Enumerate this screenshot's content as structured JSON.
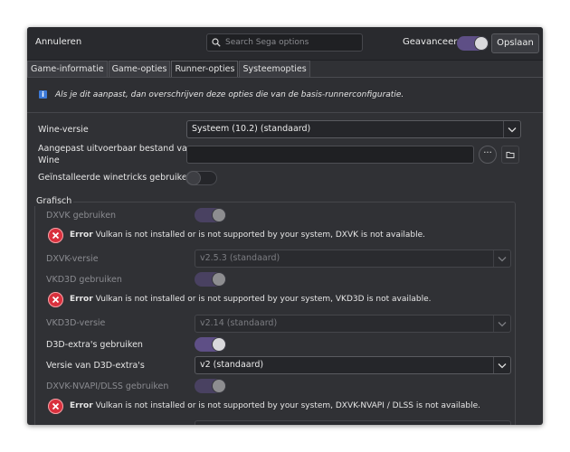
{
  "header": {
    "cancel_label": "Annuleren",
    "search_placeholder": "Search Sega options",
    "advanced_label": "Geavanceerd",
    "advanced_on": true,
    "save_label": "Opslaan"
  },
  "tabs": [
    {
      "label": "Game-informatie",
      "active": false
    },
    {
      "label": "Game-opties",
      "active": false
    },
    {
      "label": "Runner-opties",
      "active": true
    },
    {
      "label": "Systeemopties",
      "active": false
    }
  ],
  "info": {
    "icon": "info-icon",
    "text": "Als je dit aanpast, dan overschrijven deze opties die van de basis-runnerconfiguratie."
  },
  "form": {
    "wine_version_label": "Wine-versie",
    "wine_version_value": "Systeem (10.2) (standaard)",
    "custom_exe_label_1": "Aangepast uitvoerbaar bestand van",
    "custom_exe_label_2": "Wine",
    "custom_exe_value": "",
    "browse_button_label": "···",
    "winetricks_label": "Geïnstalleerde winetricks gebruiken",
    "winetricks_on": false
  },
  "graphics": {
    "title": "Grafisch",
    "dxvk_label": "DXVK gebruiken",
    "dxvk_error_label": "Error",
    "dxvk_error_text": "Vulkan is not installed or is not supported by your system, DXVK is not available.",
    "dxvk_version_label": "DXVK-versie",
    "dxvk_version_value": "v2.5.3 (standaard)",
    "vkd3d_label": "VKD3D gebruiken",
    "vkd3d_error_label": "Error",
    "vkd3d_error_text": "Vulkan is not installed or is not supported by your system, VKD3D is not available.",
    "vkd3d_version_label": "VKD3D-versie",
    "vkd3d_version_value": "v2.14 (standaard)",
    "d3d_extras_label": "D3D-extra's gebruiken",
    "d3d_extras_on": true,
    "d3d_extras_version_label": "Versie van D3D-extra's",
    "d3d_extras_version_value": "v2 (standaard)",
    "dxvk_nvapi_label": "DXVK-NVAPI/DLSS gebruiken",
    "dxvk_nvapi_error_label": "Error",
    "dxvk_nvapi_error_text": "Vulkan is not installed or is not supported by your system, DXVK-NVAPI / DLSS is not available."
  },
  "colors": {
    "window_bg": "#303135",
    "accent": "#5e4f86",
    "error": "#d9303d",
    "info": "#3d7ad8"
  }
}
